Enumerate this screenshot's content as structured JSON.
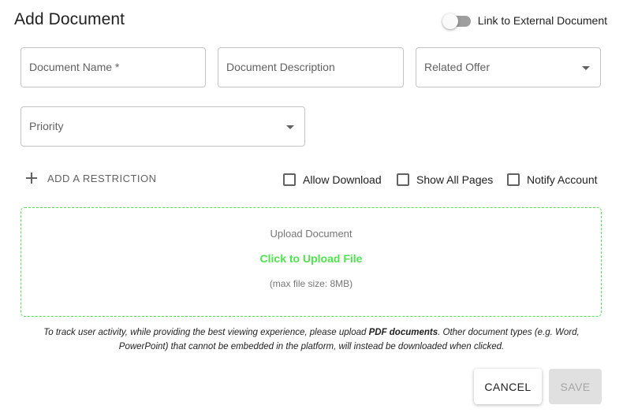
{
  "dialog": {
    "title": "Add Document",
    "external_toggle_label": "Link to External Document",
    "external_toggle_on": false
  },
  "fields": {
    "document_name": "Document Name *",
    "document_description": "Document Description",
    "related_offer": "Related Offer",
    "priority": "Priority"
  },
  "restriction": {
    "add_label": "ADD A RESTRICTION"
  },
  "options": {
    "allow_download": "Allow Download",
    "show_all_pages": "Show All Pages",
    "notify_account": "Notify Account"
  },
  "upload": {
    "title": "Upload Document",
    "link": "Click to Upload File",
    "note": "(max file size: 8MB)"
  },
  "info": {
    "before": "To track user activity, while providing the best viewing experience, please upload ",
    "bold": "PDF documents",
    "after": ". Other document types (e.g. Word, PowerPoint) that cannot be embedded in the platform, will instead be downloaded when clicked."
  },
  "actions": {
    "cancel": "CANCEL",
    "save": "SAVE"
  },
  "colors": {
    "accent_green": "#4ee44e",
    "disabled_bg": "#e0e0e0"
  }
}
